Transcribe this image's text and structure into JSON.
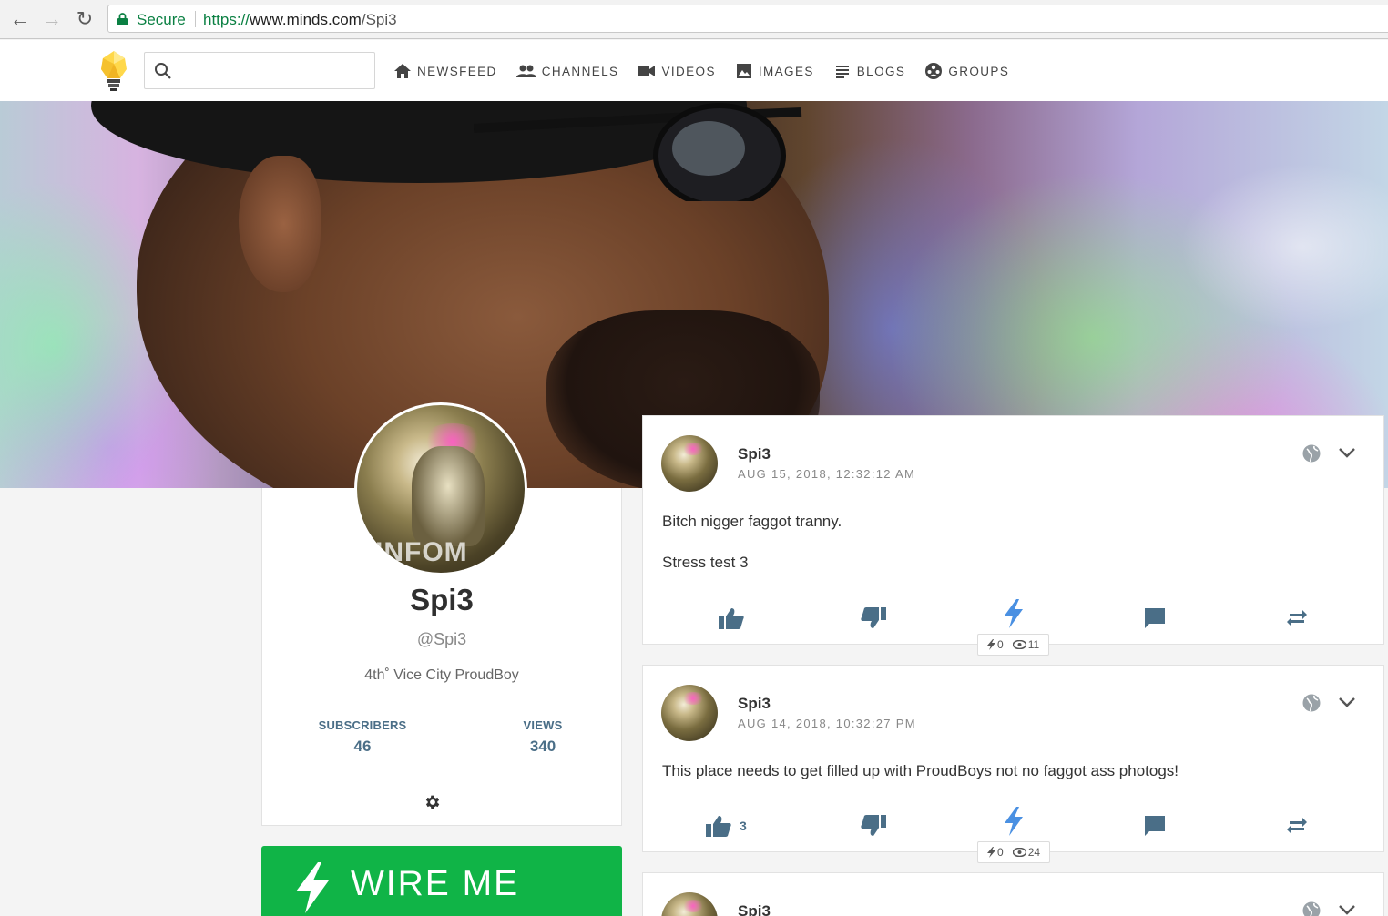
{
  "browser": {
    "secure_label": "Secure",
    "url_scheme": "https://",
    "url_host": "www.minds.com",
    "url_path": "/Spi3"
  },
  "topbar": {
    "search_placeholder": "",
    "nav": [
      {
        "label": "NEWSFEED",
        "icon": "home-icon"
      },
      {
        "label": "CHANNELS",
        "icon": "people-icon"
      },
      {
        "label": "VIDEOS",
        "icon": "video-camera-icon"
      },
      {
        "label": "IMAGES",
        "icon": "image-icon"
      },
      {
        "label": "BLOGS",
        "icon": "lines-icon"
      },
      {
        "label": "GROUPS",
        "icon": "groups-icon"
      }
    ]
  },
  "profile": {
    "name": "Spi3",
    "handle": "@Spi3",
    "bio": "4th˚ Vice City ProudBoy",
    "subscribers_label": "SUBSCRIBERS",
    "subscribers_value": "46",
    "views_label": "VIEWS",
    "views_value": "340",
    "avatar_text": "INFOM",
    "wire_label": "WIRE ME"
  },
  "posts": [
    {
      "author": "Spi3",
      "timestamp": "AUG 15, 2018, 12:32:12 AM",
      "lines": [
        "Bitch nigger faggot tranny.",
        "Stress test 3"
      ],
      "upvotes": "",
      "wires": "0",
      "views": "11"
    },
    {
      "author": "Spi3",
      "timestamp": "AUG 14, 2018, 10:32:27 PM",
      "lines": [
        "This place needs to get filled up with ProudBoys not no faggot ass photogs!"
      ],
      "upvotes": "3",
      "wires": "0",
      "views": "24"
    },
    {
      "author": "Spi3"
    }
  ],
  "colors": {
    "accent": "#4a6e87",
    "wire_green": "#10b447",
    "secure_green": "#0b8043",
    "lightning_blue": "#4a90e2"
  }
}
